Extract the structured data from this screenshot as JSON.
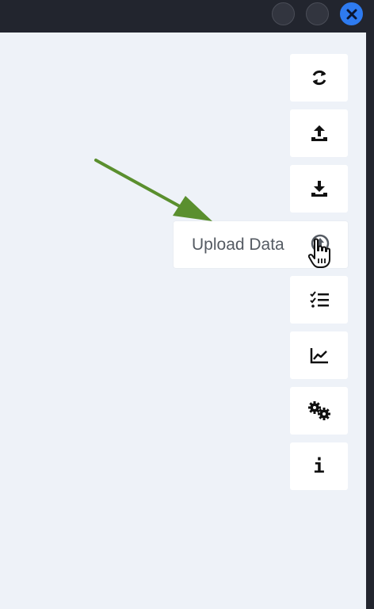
{
  "window": {
    "controls": [
      "minimize-button",
      "maximize-button",
      "close-button"
    ]
  },
  "toolbar": {
    "buttons": [
      {
        "name": "refresh-button",
        "icon": "refresh-icon"
      },
      {
        "name": "upload-button",
        "icon": "upload-icon"
      },
      {
        "name": "download-button",
        "icon": "download-icon"
      },
      {
        "name": "upload-data-button",
        "icon": "circle-upload-icon"
      },
      {
        "name": "checklist-button",
        "icon": "checklist-icon"
      },
      {
        "name": "chart-button",
        "icon": "line-chart-icon"
      },
      {
        "name": "settings-button",
        "icon": "gears-icon"
      },
      {
        "name": "info-button",
        "icon": "info-icon"
      }
    ],
    "info_glyph": "i"
  },
  "tooltip": {
    "label": "Upload Data"
  },
  "annotation": {
    "arrow_color": "#5a8f2e"
  },
  "colors": {
    "titlebar": "#22252e",
    "background": "#eef2f8",
    "close_button": "#2e7bf0",
    "icon": "#111111"
  }
}
